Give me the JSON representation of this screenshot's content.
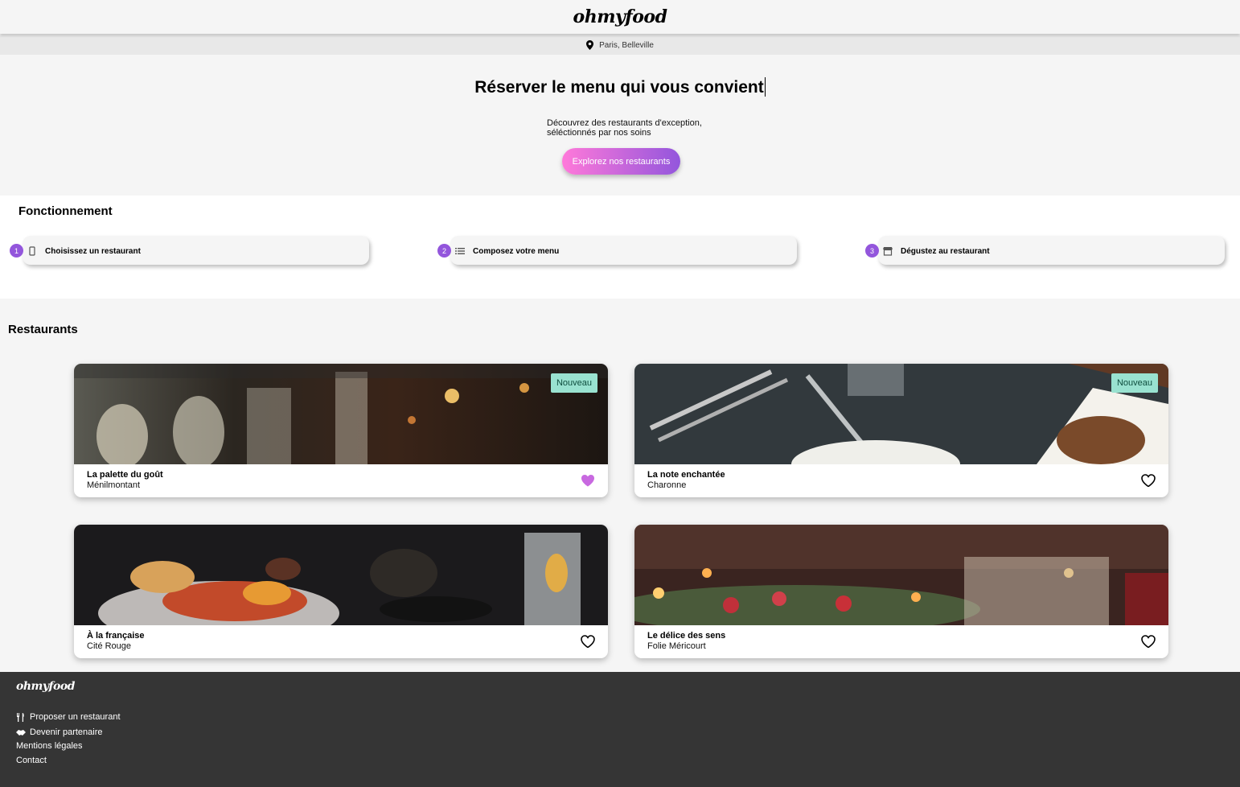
{
  "header": {
    "logo": "ohmyfood"
  },
  "location": {
    "icon": "map-pin-icon",
    "text": "Paris, Belleville"
  },
  "hero": {
    "title": "Réserver le menu qui vous convient",
    "subtitle_line1": "Découvrez des restaurants d'exception,",
    "subtitle_line2": "séléctionnés par nos soins",
    "cta_label": "Explorez nos restaurants"
  },
  "how": {
    "title": "Fonctionnement",
    "steps": [
      {
        "number": "1",
        "icon": "phone-icon",
        "label": "Choisissez un restaurant"
      },
      {
        "number": "2",
        "icon": "list-icon",
        "label": "Composez votre menu"
      },
      {
        "number": "3",
        "icon": "store-icon",
        "label": "Dégustez au restaurant"
      }
    ]
  },
  "restaurants": {
    "title": "Restaurants",
    "items": [
      {
        "name": "La palette du goût",
        "area": "Ménilmontant",
        "badge": "Nouveau",
        "liked": true
      },
      {
        "name": "La note enchantée",
        "area": "Charonne",
        "badge": "Nouveau",
        "liked": false
      },
      {
        "name": "À la française",
        "area": "Cité Rouge",
        "badge": "",
        "liked": false
      },
      {
        "name": "Le délice des sens",
        "area": "Folie Méricourt",
        "badge": "",
        "liked": false
      }
    ]
  },
  "footer": {
    "logo": "ohmyfood",
    "links": [
      {
        "icon": "utensils-icon",
        "label": "Proposer un restaurant"
      },
      {
        "icon": "handshake-icon",
        "label": "Devenir partenaire"
      },
      {
        "icon": "",
        "label": "Mentions légales"
      },
      {
        "icon": "",
        "label": "Contact"
      }
    ]
  },
  "colors": {
    "accent_pink": "#ff79da",
    "accent_purple": "#9356dc",
    "badge_bg": "#99e2d0",
    "footer_bg": "#353535"
  }
}
